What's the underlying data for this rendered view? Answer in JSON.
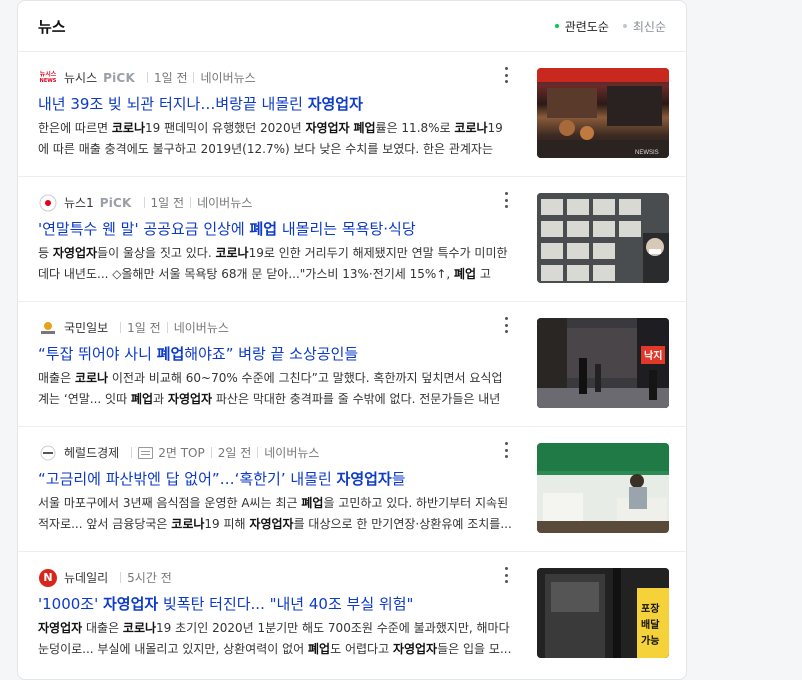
{
  "header": {
    "title": "뉴스",
    "sort": [
      "관련도순",
      "최신순"
    ]
  },
  "items": [
    {
      "press": "뉴시스",
      "press_logo_text": "뉴시스",
      "pick": "PiCK",
      "meta": [
        "1일 전",
        "네이버뉴스"
      ],
      "title": [
        {
          "t": "내년 39조 빚 뇌관 터지나…벼랑끝 내몰린 "
        },
        {
          "t": "자영업자",
          "b": true
        }
      ],
      "desc": [
        {
          "t": "한은에 따르면 "
        },
        {
          "t": "코로나",
          "b": true
        },
        {
          "t": "19 팬데믹이 유행했던 2020년 "
        },
        {
          "t": "자영업자",
          "b": true
        },
        {
          "t": " "
        },
        {
          "t": "폐업",
          "b": true
        },
        {
          "t": "률은 11.8%로 "
        },
        {
          "t": "코로나",
          "b": true
        },
        {
          "t": "19에 따른 매출 충격에도 불구하고 2019년(12.7%) 보다 낮은 수치를 보였다. 한은 관계자는 \"대..."
        }
      ],
      "thumb_caption": "NEWSIS"
    },
    {
      "press": "뉴스1",
      "pick": "PiCK",
      "meta": [
        "1일 전",
        "네이버뉴스"
      ],
      "title": [
        {
          "t": "'연말특수 웬 말' 공공요금 인상에 "
        },
        {
          "t": "폐업",
          "b": true
        },
        {
          "t": " 내몰리는 목욕탕·식당"
        }
      ],
      "desc": [
        {
          "t": "등 "
        },
        {
          "t": "자영업자",
          "b": true
        },
        {
          "t": "들이 울상을 짓고 있다. "
        },
        {
          "t": "코로나",
          "b": true
        },
        {
          "t": "19로 인한 거리두기 해제됐지만 연말 특수가 미미한데다 내년도... ◇올해만 서울 목욕탕 68개 문 닫아...\"가스비 13%·전기세 15%↑, "
        },
        {
          "t": "폐업",
          "b": true
        },
        {
          "t": " 고민..."
        }
      ]
    },
    {
      "press": "국민일보",
      "meta": [
        "1일 전",
        "네이버뉴스"
      ],
      "title": [
        {
          "t": "“투잡 뛰어야 사니 "
        },
        {
          "t": "폐업",
          "b": true
        },
        {
          "t": "해야죠” 벼랑 끝 소상공인들"
        }
      ],
      "desc": [
        {
          "t": "매출은 "
        },
        {
          "t": "코로나",
          "b": true
        },
        {
          "t": " 이전과 비교해 60~70% 수준에 그친다”고 말했다. 혹한까지 덮치면서 요식업계는 ‘연말... 잇따 "
        },
        {
          "t": "폐업",
          "b": true
        },
        {
          "t": "과 "
        },
        {
          "t": "자영업자",
          "b": true
        },
        {
          "t": " 파산은 막대한 충격파를 줄 수밖에 없다. 전문가들은 내년 경..."
        }
      ],
      "thumb_sign": "낙지"
    },
    {
      "press": "헤럴드경제",
      "meta": [
        "2면 TOP",
        "2일 전",
        "네이버뉴스"
      ],
      "title": [
        {
          "t": "“고금리에 파산밖엔 답 없어”…‘혹한기’ 내몰린 "
        },
        {
          "t": "자영업자",
          "b": true
        },
        {
          "t": "들"
        }
      ],
      "desc": [
        {
          "t": "서울 마포구에서 3년째 음식점을 운영한 A씨는 최근 "
        },
        {
          "t": "폐업",
          "b": true
        },
        {
          "t": "을 고민하고 있다. 하반기부터 지속된 적자로... 앞서 금융당국은 "
        },
        {
          "t": "코로나",
          "b": true
        },
        {
          "t": "19 피해 "
        },
        {
          "t": "자영업자",
          "b": true
        },
        {
          "t": "를 대상으로 한 만기연장·상환유예 조치를..."
        }
      ]
    },
    {
      "press": "뉴데일리",
      "press_logo_text": "N",
      "meta": [
        "5시간 전"
      ],
      "title": [
        {
          "t": "'1000조' "
        },
        {
          "t": "자영업자",
          "b": true
        },
        {
          "t": " 빚폭탄 터진다... \"내년 40조 부실 위험\""
        }
      ],
      "desc": [
        {
          "t": "자영업자",
          "b": true
        },
        {
          "t": " 대출은 "
        },
        {
          "t": "코로나",
          "b": true
        },
        {
          "t": "19 초기인 2020년 1분기만 해도 700조원 수준에 불과했지만, 해마다 눈덩이로... 부실에 내몰리고 있지만, 상환여력이 없어 "
        },
        {
          "t": "폐업",
          "b": true
        },
        {
          "t": "도 어렵다고 "
        },
        {
          "t": "자영업자",
          "b": true
        },
        {
          "t": "들은 입을 모..."
        }
      ],
      "thumb_sign": [
        "포장",
        "배달",
        "가능"
      ]
    }
  ],
  "colors": {
    "accent": "#03c75a",
    "title_link": "#0d3ac8"
  }
}
